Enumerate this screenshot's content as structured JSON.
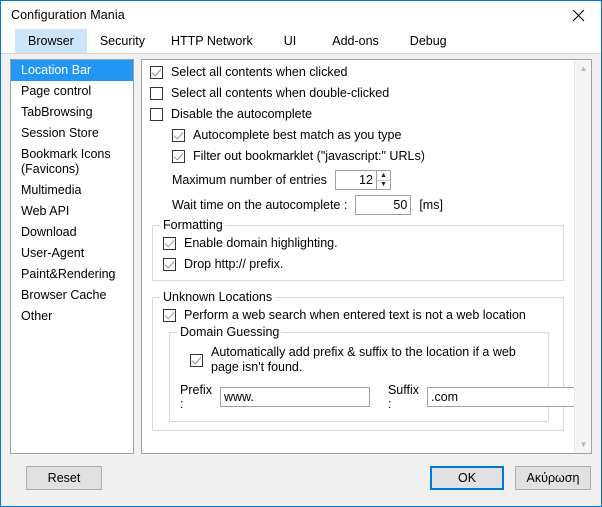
{
  "window": {
    "title": "Configuration Mania",
    "close_icon": "close-icon"
  },
  "tabs": [
    {
      "label": "Browser",
      "selected": true
    },
    {
      "label": "Security",
      "selected": false
    },
    {
      "label": "HTTP Network",
      "selected": false
    },
    {
      "label": "UI",
      "selected": false
    },
    {
      "label": "Add-ons",
      "selected": false
    },
    {
      "label": "Debug",
      "selected": false
    }
  ],
  "sidebar": {
    "items": [
      {
        "label": "Location Bar",
        "selected": true
      },
      {
        "label": "Page control",
        "selected": false
      },
      {
        "label": "TabBrowsing",
        "selected": false
      },
      {
        "label": "Session Store",
        "selected": false
      },
      {
        "label": "Bookmark Icons\n(Favicons)",
        "selected": false
      },
      {
        "label": "Multimedia",
        "selected": false
      },
      {
        "label": "Web API",
        "selected": false
      },
      {
        "label": "Download",
        "selected": false
      },
      {
        "label": "User-Agent",
        "selected": false
      },
      {
        "label": "Paint&Rendering",
        "selected": false
      },
      {
        "label": "Browser Cache",
        "selected": false
      },
      {
        "label": "Other",
        "selected": false
      }
    ]
  },
  "panel": {
    "checkboxes": {
      "select_all_clicked": {
        "label": "Select all contents when clicked",
        "checked": true
      },
      "select_all_double_clicked": {
        "label": "Select all contents when double-clicked",
        "checked": false
      },
      "disable_autocomplete": {
        "label": "Disable the autocomplete",
        "checked": false
      },
      "autocomplete_best_match": {
        "label": "Autocomplete best match as you type",
        "checked": true
      },
      "filter_bookmarklet": {
        "label": "Filter out bookmarklet (\"javascript:\" URLs)",
        "checked": true
      }
    },
    "max_entries": {
      "label": "Maximum number of entries",
      "value": "12"
    },
    "wait_time": {
      "label": "Wait time on the autocomplete :",
      "value": "50",
      "unit": "[ms]"
    },
    "formatting": {
      "legend": "Formatting",
      "enable_domain_highlighting": {
        "label": "Enable domain highlighting.",
        "checked": true
      },
      "drop_http_prefix": {
        "label": "Drop http:// prefix.",
        "checked": true
      }
    },
    "unknown_locations": {
      "legend": "Unknown Locations",
      "perform_web_search": {
        "label": "Perform a web search when entered text is not a web location",
        "checked": true
      },
      "domain_guessing": {
        "legend": "Domain Guessing",
        "auto_add": {
          "label": "Automatically add prefix & suffix to the location if a web page isn't found.",
          "checked": true
        },
        "prefix": {
          "label": "Prefix :",
          "value": "www."
        },
        "suffix": {
          "label": "Suffix :",
          "value": ".com"
        }
      }
    },
    "scrollbar": {
      "up_icon": "chevron-up-icon",
      "down_icon": "chevron-down-icon"
    }
  },
  "buttons": {
    "reset": "Reset",
    "ok": "OK",
    "cancel": "Ακύρωση"
  }
}
